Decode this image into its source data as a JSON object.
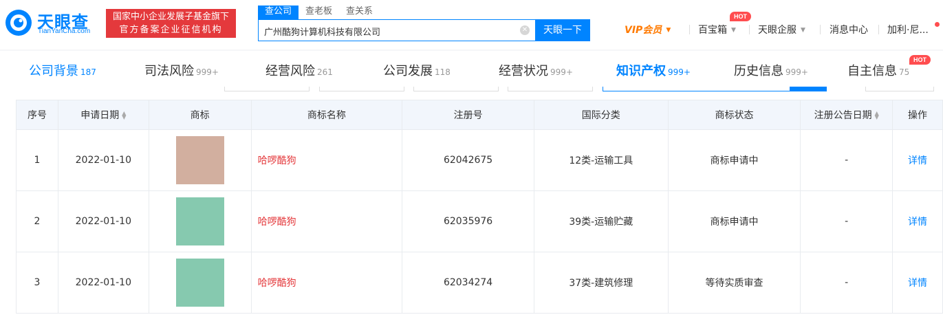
{
  "header": {
    "logo_text": "天眼查",
    "logo_sub": "TianYanCha.com",
    "banner_line1": "国家中小企业发展子基金旗下",
    "banner_line2": "官方备案企业征信机构",
    "search_tabs": [
      "查公司",
      "查老板",
      "查关系"
    ],
    "search_value": "广州酷狗计算机科技有限公司",
    "search_button": "天眼一下",
    "nav": {
      "vip": "VIP会员",
      "baibao": "百宝箱",
      "qifu": "天眼企服",
      "messages": "消息中心",
      "user": "加利·尼...",
      "hot": "HOT"
    }
  },
  "section_tabs": [
    {
      "label": "公司背景",
      "count": "187"
    },
    {
      "label": "司法风险",
      "count": "999+"
    },
    {
      "label": "经营风险",
      "count": "261"
    },
    {
      "label": "公司发展",
      "count": "118"
    },
    {
      "label": "经营状况",
      "count": "999+"
    },
    {
      "label": "知识产权",
      "count": "999+"
    },
    {
      "label": "历史信息",
      "count": "999+"
    },
    {
      "label": "自主信息",
      "count": "75"
    }
  ],
  "section_hot": "HOT",
  "table": {
    "headers": [
      "序号",
      "申请日期",
      "商标",
      "商标名称",
      "注册号",
      "国际分类",
      "商标状态",
      "注册公告日期",
      "操作"
    ],
    "rows": [
      {
        "no": "1",
        "date": "2022-01-10",
        "mark_color": "#d2af9f",
        "name": "哈啰酷狗",
        "reg": "62042675",
        "cls": "12类-运输工具",
        "status": "商标申请中",
        "notice": "-",
        "op": "详情"
      },
      {
        "no": "2",
        "date": "2022-01-10",
        "mark_color": "#86c9af",
        "name": "哈啰酷狗",
        "reg": "62035976",
        "cls": "39类-运输贮藏",
        "status": "商标申请中",
        "notice": "-",
        "op": "详情"
      },
      {
        "no": "3",
        "date": "2022-01-10",
        "mark_color": "#86c9af",
        "name": "哈啰酷狗",
        "reg": "62034274",
        "cls": "37类-建筑修理",
        "status": "等待实质审查",
        "notice": "-",
        "op": "详情"
      }
    ]
  },
  "colors": {
    "brand": "#0084ff",
    "red": "#e4393c",
    "vip": "#ff7a00"
  }
}
